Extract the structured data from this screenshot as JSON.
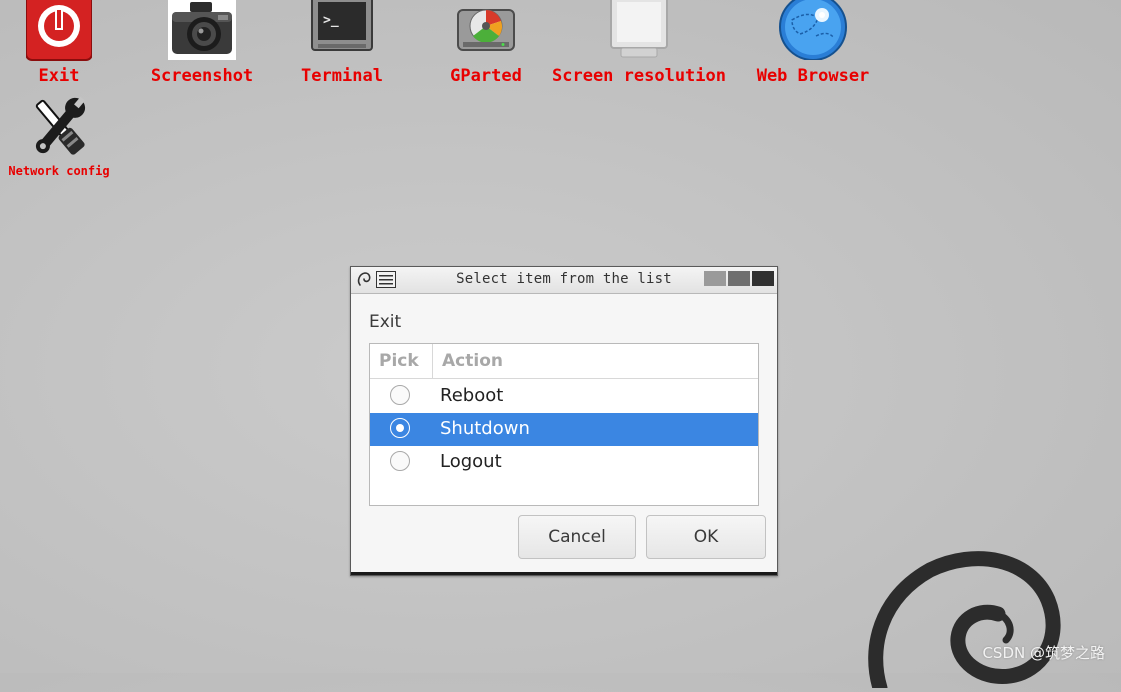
{
  "desktop": {
    "icons": [
      {
        "label": "Exit",
        "icon": "power-icon"
      },
      {
        "label": "Screenshot",
        "icon": "camera-icon"
      },
      {
        "label": "Terminal",
        "icon": "terminal-icon"
      },
      {
        "label": "GParted",
        "icon": "gparted-disk-icon"
      },
      {
        "label": "Screen resolution",
        "icon": "monitor-icon"
      },
      {
        "label": "Web Browser",
        "icon": "globe-icon"
      },
      {
        "label": "Network config",
        "icon": "wrench-screwdriver-icon"
      }
    ],
    "label_color": "#e80000",
    "background_logo": "debian-swirl-icon"
  },
  "dialog": {
    "title": "Select item from the list",
    "label": "Exit",
    "columns": [
      "Pick",
      "Action"
    ],
    "rows": [
      {
        "action": "Reboot",
        "selected": false
      },
      {
        "action": "Shutdown",
        "selected": true
      },
      {
        "action": "Logout",
        "selected": false
      }
    ],
    "cancel_label": "Cancel",
    "ok_label": "OK",
    "selection_color": "#3b86e2"
  },
  "watermark": "CSDN @筑梦之路"
}
